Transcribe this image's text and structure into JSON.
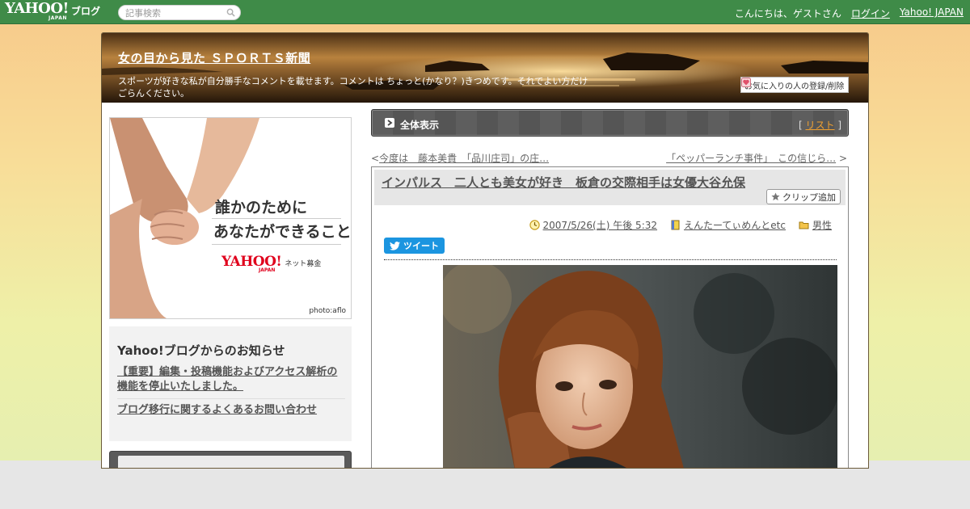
{
  "topbar": {
    "logo_text": "YAHOO!",
    "logo_japan": "JAPAN",
    "logo_blog": "ブログ",
    "search_placeholder": "記事検索",
    "greeting": "こんにちは、ゲストさん",
    "login_label": "ログイン",
    "yahoo_japan_label": "Yahoo! JAPAN"
  },
  "header": {
    "blog_title": "女の目から見た ＳＰＯＲＴＳ新聞",
    "description": "スポーツが好きな私が自分勝手なコメントを載せます。コメントは ちょっと(かなり？)きつめです。それでよい方だけごらんください。",
    "fav_label": "お気に入りの人の登録/削除"
  },
  "sidebar": {
    "ad": {
      "line1": "誰かのために",
      "line2": "あなたができること",
      "logo": "YAHOO!",
      "logo_japan": "JAPAN",
      "logo_sub": "ネット募金",
      "credit": "photo:aflo"
    },
    "notice": {
      "title": "Yahoo!ブログからのお知らせ",
      "links": [
        "【重要】編集・投稿機能およびアクセス解析の機能を停止いたしました。",
        "ブログ移行に関するよくあるお問い合わせ"
      ]
    }
  },
  "main": {
    "listbar": {
      "label": "全体表示",
      "bracket_open": "[",
      "list_link": "リスト",
      "bracket_close": "]"
    },
    "nav": {
      "prev_arrow": "<",
      "prev_label": "今度は　藤本美貴　「品川庄司」の庄…",
      "next_label": "「ペッパーランチ事件」　この信じら…",
      "next_arrow": ">"
    },
    "article": {
      "title": "インパルス　二人とも美女が好き　板倉の交際相手は女優大谷允保",
      "clip_label": "クリップ追加",
      "date": "2007/5/26(土) 午後 5:32",
      "category": "えんたーてぃめんとetc",
      "folder": "男性",
      "tweet_label": "ツイート"
    }
  },
  "colors": {
    "topbar": "#3f8b48",
    "accent_link": "#f0a030",
    "tweet": "#1b95e0"
  }
}
